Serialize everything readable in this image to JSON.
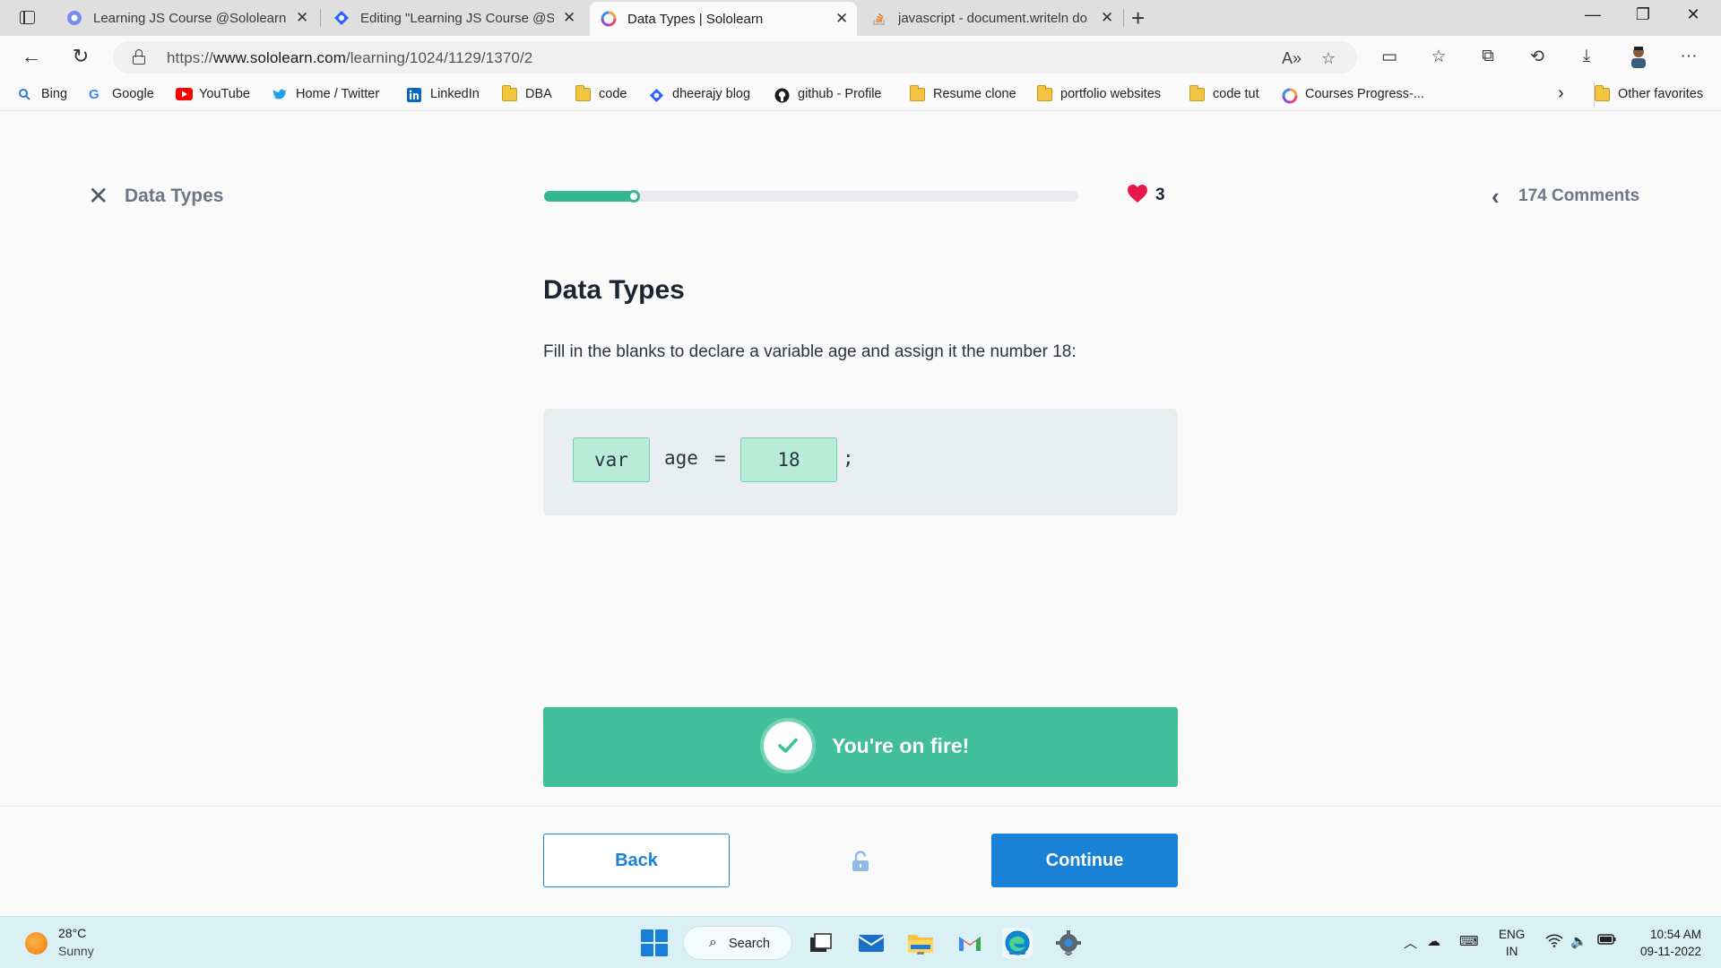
{
  "browser": {
    "tabs": [
      {
        "title": "Learning JS Course @Sololearn -",
        "active": false
      },
      {
        "title": "Editing \"Learning JS Course @So",
        "active": false
      },
      {
        "title": "Data Types | Sololearn",
        "active": true
      },
      {
        "title": "javascript - document.writeln do",
        "active": false
      }
    ],
    "url_prefix": "https://",
    "url_host": "www.sololearn.com",
    "url_path": "/learning/1024/1129/1370/2",
    "favorites": [
      {
        "label": "Bing",
        "icon": "search-icon"
      },
      {
        "label": "Google",
        "icon": "google-icon"
      },
      {
        "label": "YouTube",
        "icon": "youtube-icon"
      },
      {
        "label": "Home / Twitter",
        "icon": "twitter-icon"
      },
      {
        "label": "LinkedIn",
        "icon": "linkedin-icon"
      },
      {
        "label": "DBA",
        "icon": "folder-icon"
      },
      {
        "label": "code",
        "icon": "folder-icon"
      },
      {
        "label": "dheerajy blog",
        "icon": "blog-icon"
      },
      {
        "label": "github - Profile",
        "icon": "github-icon"
      },
      {
        "label": "Resume clone",
        "icon": "folder-icon"
      },
      {
        "label": "portfolio websites",
        "icon": "folder-icon"
      },
      {
        "label": "code tut",
        "icon": "folder-icon"
      },
      {
        "label": "Courses Progress-...",
        "icon": "sololearn-icon"
      }
    ],
    "other_favorites": "Other favorites"
  },
  "lesson": {
    "header_title": "Data Types",
    "progress_fraction": 0.17,
    "lives": "3",
    "comments": "174 Comments",
    "heading": "Data Types",
    "instruction": "Fill in the blanks to declare a variable age and assign it the number 18:",
    "code": {
      "blank1": "var",
      "token_name": "age",
      "token_eq": "=",
      "blank2": "18",
      "token_end": ";"
    },
    "feedback": "You're on fire!",
    "back_label": "Back",
    "continue_label": "Continue"
  },
  "taskbar": {
    "temperature": "28°C",
    "condition": "Sunny",
    "search_label": "Search",
    "lang_line1": "ENG",
    "lang_line2": "IN",
    "time": "10:54 AM",
    "date": "09-11-2022"
  },
  "colors": {
    "accent_green": "#40bf9a",
    "primary_blue": "#1a82d6",
    "heart_red": "#e8174b"
  }
}
